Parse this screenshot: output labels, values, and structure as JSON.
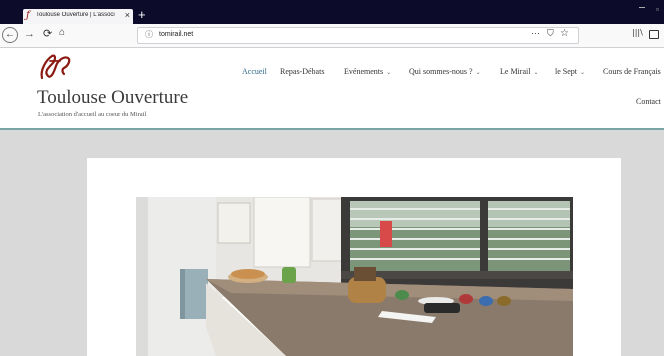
{
  "browser": {
    "tab": {
      "title": "Toulouse Ouverture | L'associ",
      "close": "×"
    },
    "new_tab": "+",
    "url": "tomirail.net",
    "url_more": "···",
    "icons": [
      "back-arrow-icon",
      "forward-arrow-icon",
      "reload-icon",
      "home-icon",
      "info-icon",
      "pocket-icon",
      "star-icon",
      "library-icon",
      "sidebar-icon"
    ]
  },
  "site": {
    "logo_mark": "t.o",
    "title": "Toulouse Ouverture",
    "tagline": "L'association d'accueil au coeur du Mirail",
    "accent_color": "#2f6a87",
    "logo_color": "#8b1a12",
    "menu": [
      {
        "label": "Accueil",
        "active": true
      },
      {
        "label": "Repas-Débats"
      },
      {
        "label": "Evénements",
        "dropdown": true
      },
      {
        "label": "Qui sommes-nous ?",
        "dropdown": true
      },
      {
        "label": "Le Mirail",
        "dropdown": true
      },
      {
        "label": "le Sept",
        "dropdown": true
      },
      {
        "label": "Cours de Français"
      },
      {
        "label": "Contact"
      }
    ],
    "chevron": "⌄"
  }
}
